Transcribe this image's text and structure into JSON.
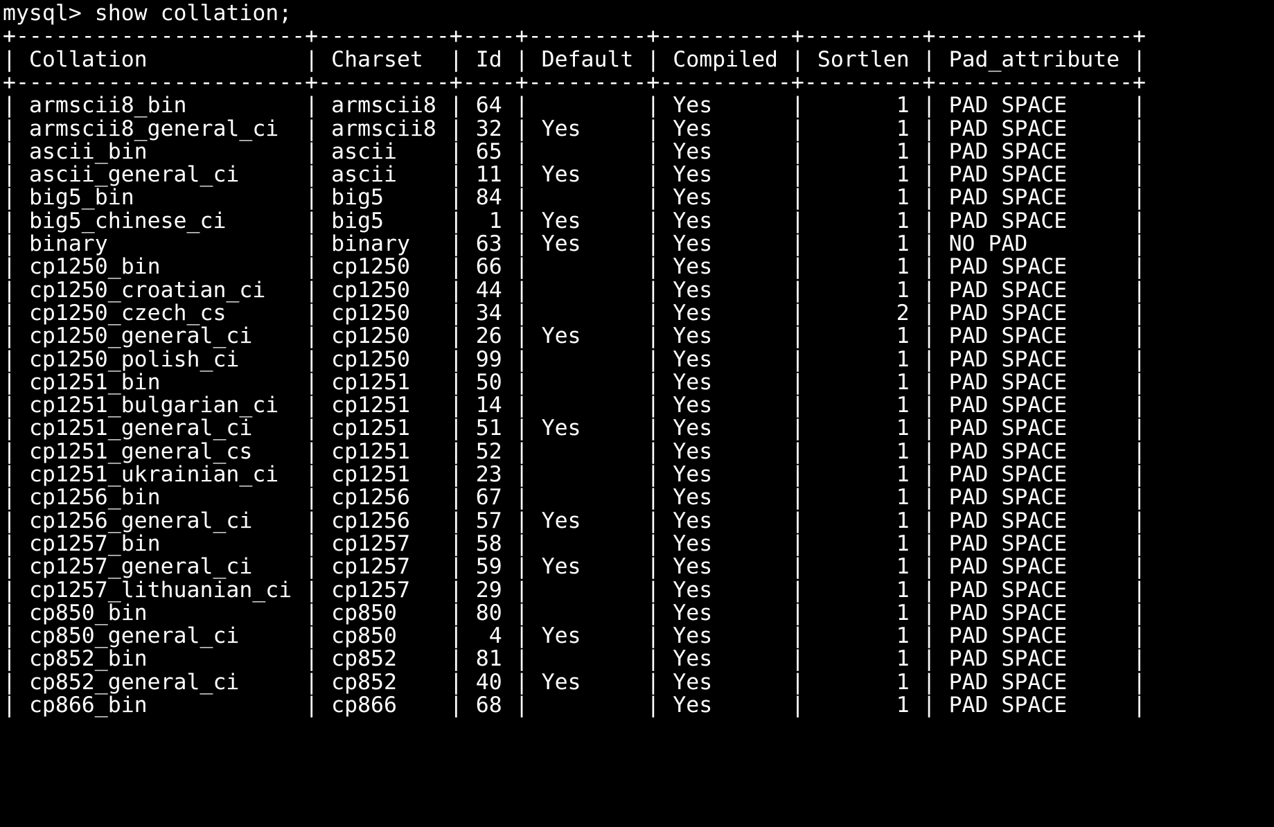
{
  "terminal": {
    "prompt": "mysql>",
    "command": "show collation;",
    "foreground_color": "#ffffff",
    "background_color": "#000000"
  },
  "table": {
    "columns": [
      {
        "name": "Collation",
        "align": "left"
      },
      {
        "name": "Charset",
        "align": "left"
      },
      {
        "name": "Id",
        "align": "right"
      },
      {
        "name": "Default",
        "align": "left"
      },
      {
        "name": "Compiled",
        "align": "left"
      },
      {
        "name": "Sortlen",
        "align": "right"
      },
      {
        "name": "Pad_attribute",
        "align": "left"
      }
    ],
    "rows": [
      [
        "armscii8_bin",
        "armscii8",
        "64",
        "",
        "Yes",
        "1",
        "PAD SPACE"
      ],
      [
        "armscii8_general_ci",
        "armscii8",
        "32",
        "Yes",
        "Yes",
        "1",
        "PAD SPACE"
      ],
      [
        "ascii_bin",
        "ascii",
        "65",
        "",
        "Yes",
        "1",
        "PAD SPACE"
      ],
      [
        "ascii_general_ci",
        "ascii",
        "11",
        "Yes",
        "Yes",
        "1",
        "PAD SPACE"
      ],
      [
        "big5_bin",
        "big5",
        "84",
        "",
        "Yes",
        "1",
        "PAD SPACE"
      ],
      [
        "big5_chinese_ci",
        "big5",
        "1",
        "Yes",
        "Yes",
        "1",
        "PAD SPACE"
      ],
      [
        "binary",
        "binary",
        "63",
        "Yes",
        "Yes",
        "1",
        "NO PAD"
      ],
      [
        "cp1250_bin",
        "cp1250",
        "66",
        "",
        "Yes",
        "1",
        "PAD SPACE"
      ],
      [
        "cp1250_croatian_ci",
        "cp1250",
        "44",
        "",
        "Yes",
        "1",
        "PAD SPACE"
      ],
      [
        "cp1250_czech_cs",
        "cp1250",
        "34",
        "",
        "Yes",
        "2",
        "PAD SPACE"
      ],
      [
        "cp1250_general_ci",
        "cp1250",
        "26",
        "Yes",
        "Yes",
        "1",
        "PAD SPACE"
      ],
      [
        "cp1250_polish_ci",
        "cp1250",
        "99",
        "",
        "Yes",
        "1",
        "PAD SPACE"
      ],
      [
        "cp1251_bin",
        "cp1251",
        "50",
        "",
        "Yes",
        "1",
        "PAD SPACE"
      ],
      [
        "cp1251_bulgarian_ci",
        "cp1251",
        "14",
        "",
        "Yes",
        "1",
        "PAD SPACE"
      ],
      [
        "cp1251_general_ci",
        "cp1251",
        "51",
        "Yes",
        "Yes",
        "1",
        "PAD SPACE"
      ],
      [
        "cp1251_general_cs",
        "cp1251",
        "52",
        "",
        "Yes",
        "1",
        "PAD SPACE"
      ],
      [
        "cp1251_ukrainian_ci",
        "cp1251",
        "23",
        "",
        "Yes",
        "1",
        "PAD SPACE"
      ],
      [
        "cp1256_bin",
        "cp1256",
        "67",
        "",
        "Yes",
        "1",
        "PAD SPACE"
      ],
      [
        "cp1256_general_ci",
        "cp1256",
        "57",
        "Yes",
        "Yes",
        "1",
        "PAD SPACE"
      ],
      [
        "cp1257_bin",
        "cp1257",
        "58",
        "",
        "Yes",
        "1",
        "PAD SPACE"
      ],
      [
        "cp1257_general_ci",
        "cp1257",
        "59",
        "Yes",
        "Yes",
        "1",
        "PAD SPACE"
      ],
      [
        "cp1257_lithuanian_ci",
        "cp1257",
        "29",
        "",
        "Yes",
        "1",
        "PAD SPACE"
      ],
      [
        "cp850_bin",
        "cp850",
        "80",
        "",
        "Yes",
        "1",
        "PAD SPACE"
      ],
      [
        "cp850_general_ci",
        "cp850",
        "4",
        "Yes",
        "Yes",
        "1",
        "PAD SPACE"
      ],
      [
        "cp852_bin",
        "cp852",
        "81",
        "",
        "Yes",
        "1",
        "PAD SPACE"
      ],
      [
        "cp852_general_ci",
        "cp852",
        "40",
        "Yes",
        "Yes",
        "1",
        "PAD SPACE"
      ],
      [
        "cp866_bin",
        "cp866",
        "68",
        "",
        "Yes",
        "1",
        "PAD SPACE"
      ]
    ]
  }
}
